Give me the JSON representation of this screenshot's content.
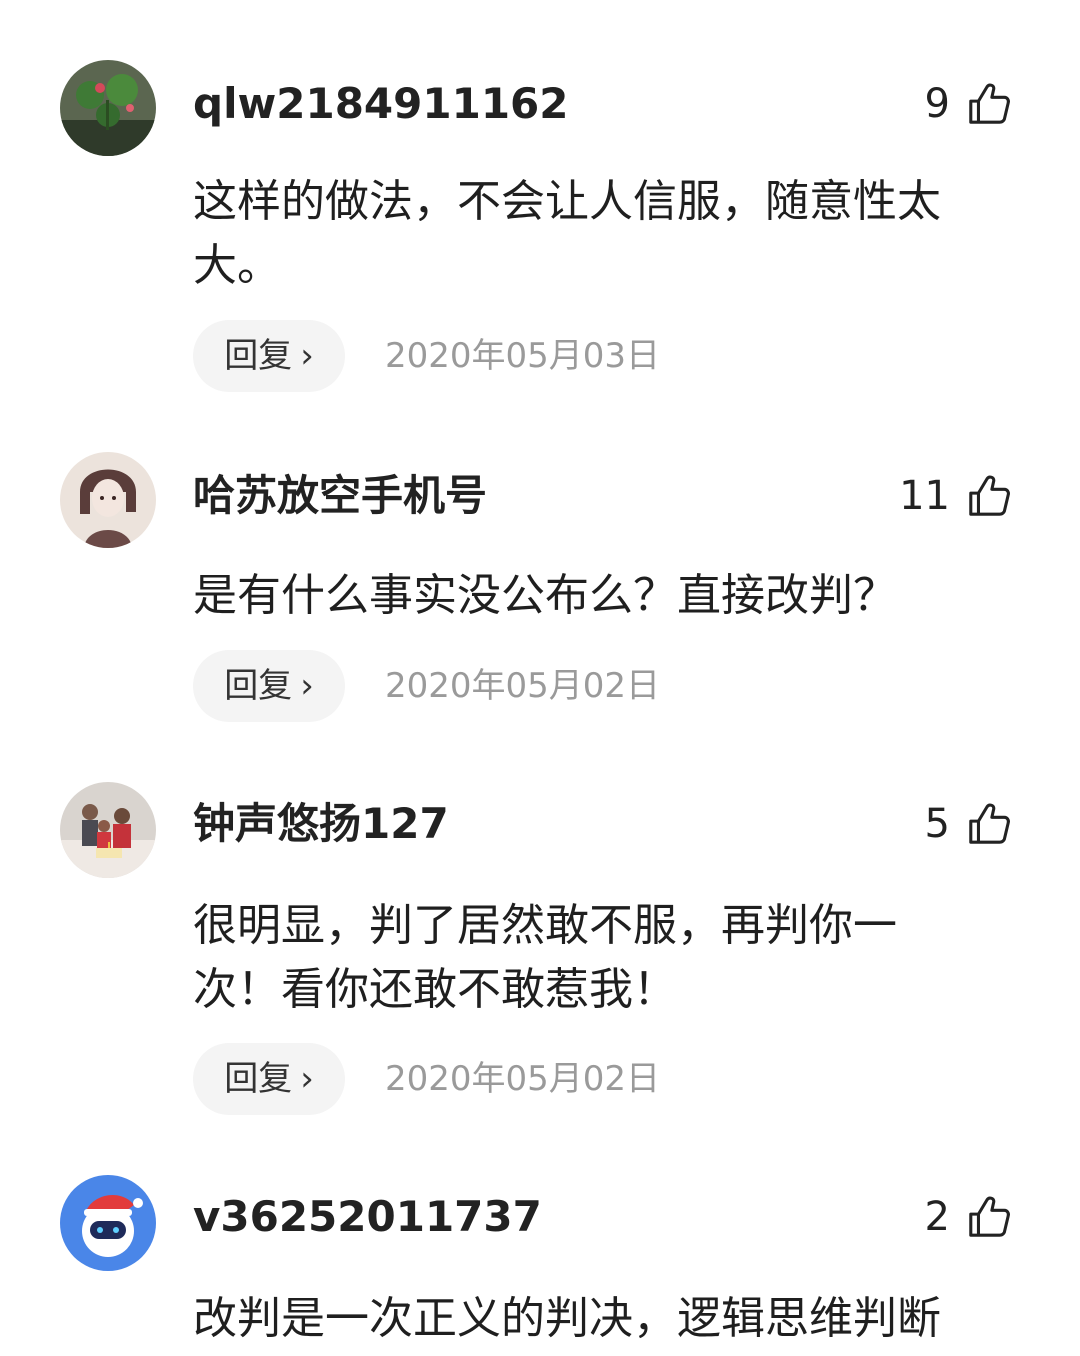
{
  "comments": [
    {
      "username": "qlw2184911162",
      "likes": "9",
      "content": "这样的做法，不会让人信服，随意性太大。",
      "reply_label": "回复",
      "reply_chevron": "›",
      "date": "2020年05月03日",
      "avatar_icon": "lotus-plant-avatar"
    },
    {
      "username": "哈苏放空手机号",
      "likes": "11",
      "content": "是有什么事实没公布么？直接改判？",
      "reply_label": "回复",
      "reply_chevron": "›",
      "date": "2020年05月02日",
      "avatar_icon": "anime-portrait-avatar"
    },
    {
      "username": "钟声悠扬127",
      "likes": "5",
      "content": "很明显，判了居然敢不服，再判你一次！看你还敢不敢惹我！",
      "reply_label": "回复",
      "reply_chevron": "›",
      "date": "2020年05月02日",
      "avatar_icon": "family-photo-avatar"
    },
    {
      "username": "v36252011737",
      "likes": "2",
      "content": "改判是一次正义的判决，逻辑思维判断",
      "avatar_icon": "robot-santa-avatar"
    }
  ],
  "colors": {
    "text": "#1f1f1f",
    "date": "#9a9a9a",
    "reply_bg": "#f4f4f4"
  },
  "icons": {
    "like": "thumbs-up-icon",
    "reply_arrow": "chevron-right-icon"
  }
}
